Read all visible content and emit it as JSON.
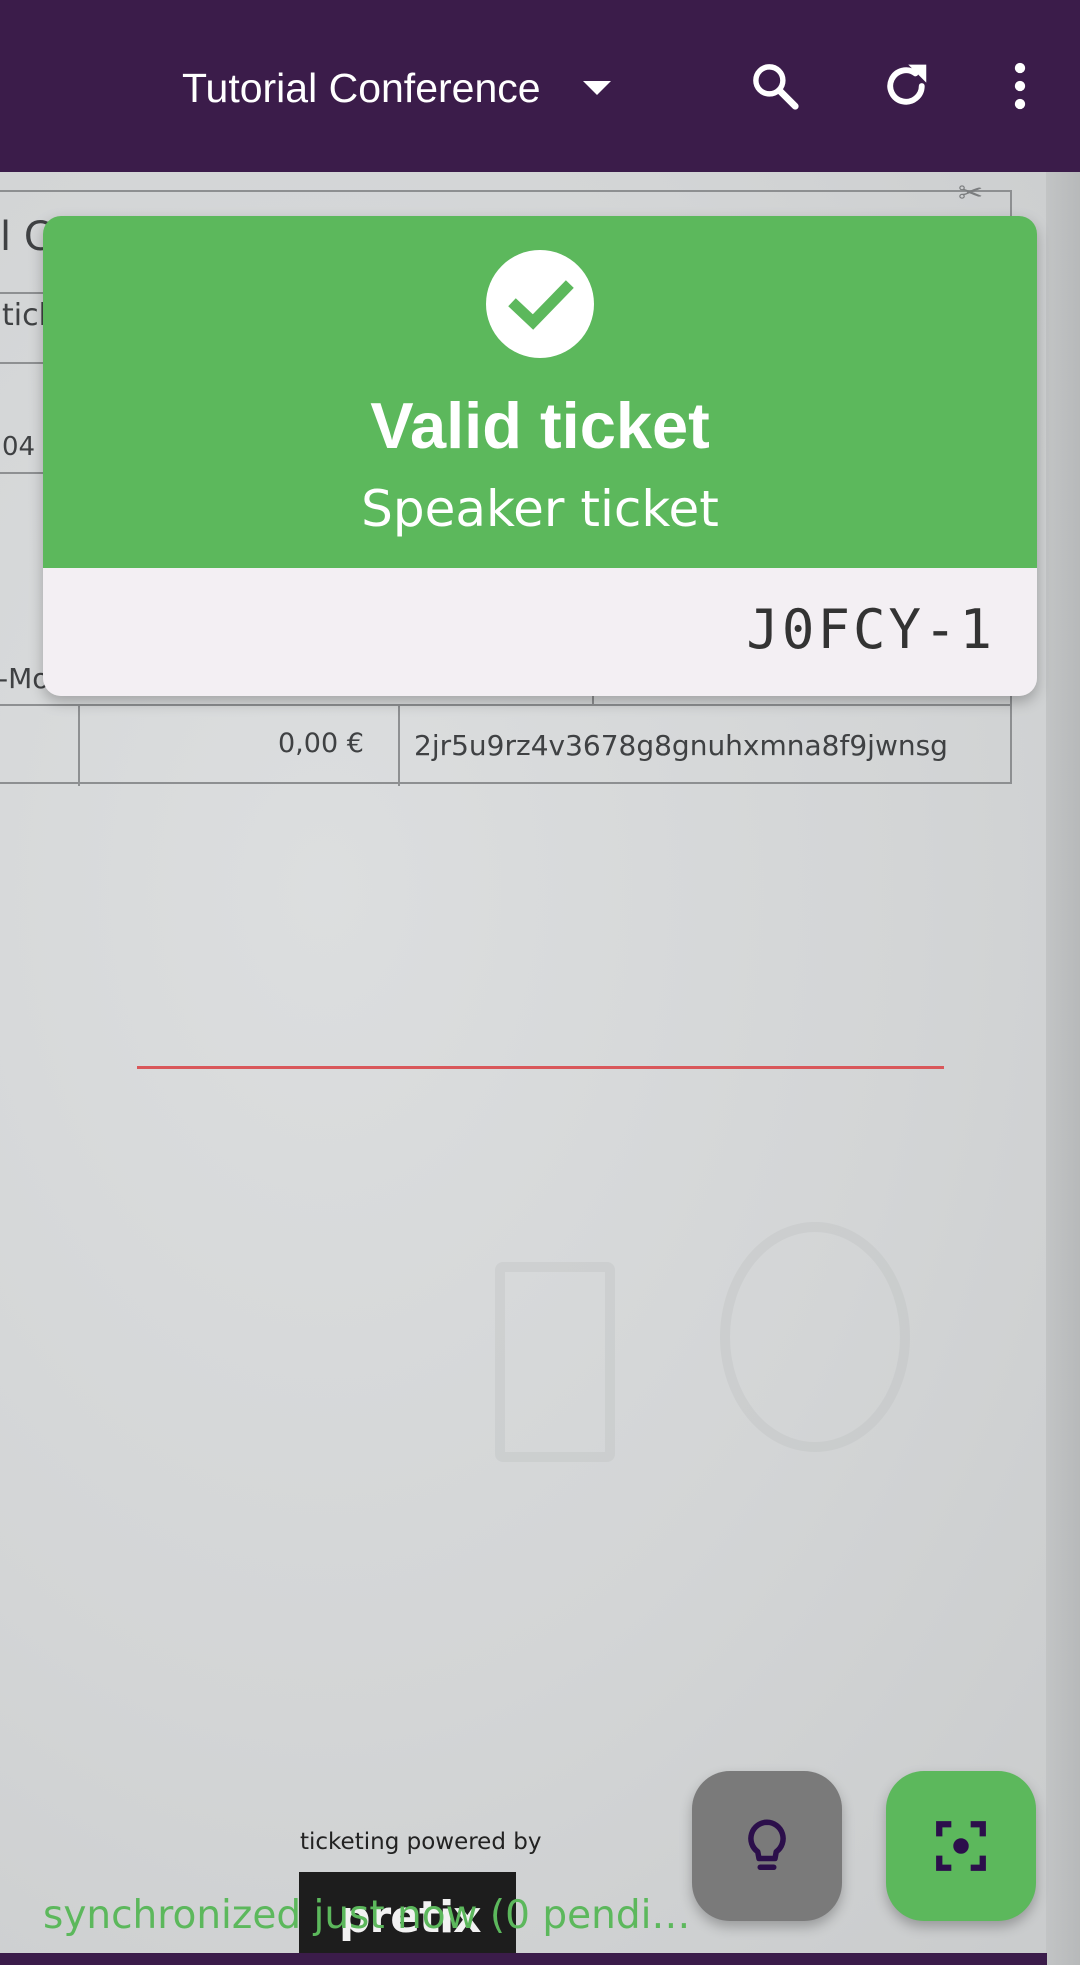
{
  "toolbar": {
    "title": "Tutorial Conference",
    "dropdown_icon": "arrow-drop-down-icon",
    "search_icon": "search-icon",
    "refresh_icon": "refresh-icon",
    "more_icon": "more-vertical-icon",
    "background_color": "#3b1c4a"
  },
  "result": {
    "status_icon": "check-circle-icon",
    "title": "Valid ticket",
    "subtitle": "Speaker ticket",
    "ticket_code": "J0FCY-1",
    "accent_color": "#5cb85c"
  },
  "camera": {
    "paper_fragments": [
      "l C",
      "tick",
      "04 (",
      "-Mo"
    ],
    "price": "0,00 €",
    "secret": "2jr5u9rz4v3678g8gnuhxmna8f9jwnsg",
    "powered_by": "ticketing powered by",
    "logo_text": "pretix"
  },
  "actions": {
    "flashlight_icon": "lightbulb-icon",
    "scan_icon": "center-focus-icon"
  },
  "status": {
    "sync_text": "synchronized just now (0 pendi…"
  }
}
